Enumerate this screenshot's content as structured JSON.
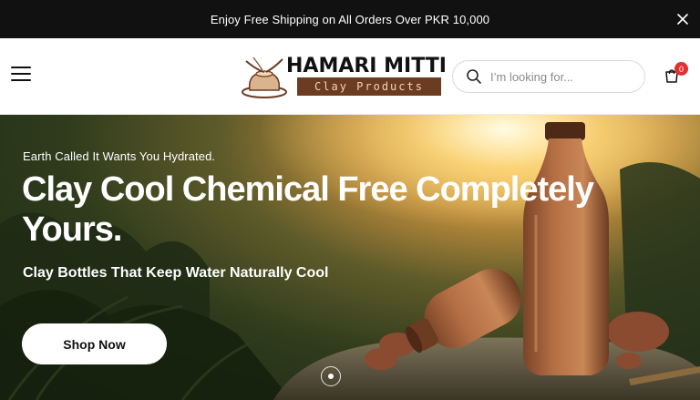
{
  "announcement": {
    "text": "Enjoy Free Shipping on All Orders Over PKR 10,000",
    "close_icon": "close-icon"
  },
  "header": {
    "menu_icon": "hamburger-menu-icon",
    "logo": {
      "name": "HAMARI MITTI",
      "tagline": "Clay Products",
      "colors": {
        "tagline_bg": "#6b3b22",
        "tagline_text": "#f1d6b6"
      }
    },
    "search": {
      "placeholder": "I’m looking for...",
      "icon": "search-icon"
    },
    "cart": {
      "icon": "shopping-bag-icon",
      "count": "0",
      "badge_color": "#e0302f"
    }
  },
  "hero": {
    "kicker": "Earth Called It Wants You Hydrated.",
    "headline": "Clay Cool Chemical Free Completely Yours.",
    "subheadline": "Clay Bottles That Keep Water Naturally Cool",
    "cta_label": "Shop Now",
    "slider_dots": 1,
    "active_slide": 1
  }
}
